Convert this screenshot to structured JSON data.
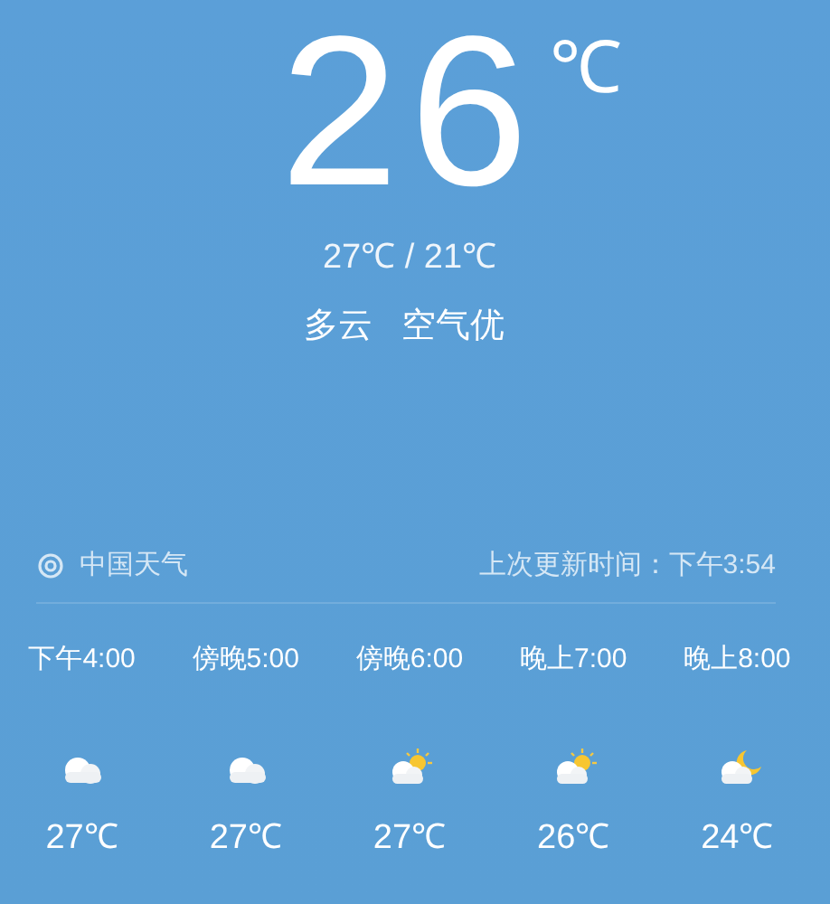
{
  "current": {
    "temperature": "26",
    "unit": "℃",
    "high_low": "27℃ / 21℃",
    "condition": "多云",
    "air_quality": "空气优"
  },
  "source": {
    "name": "中国天气",
    "updated": "上次更新时间：下午3:54"
  },
  "hourly": [
    {
      "time": "下午4:00",
      "kind": "cloudy",
      "temp": "27℃"
    },
    {
      "time": "傍晚5:00",
      "kind": "cloudy",
      "temp": "27℃"
    },
    {
      "time": "傍晚6:00",
      "kind": "partly-sunny",
      "temp": "27℃"
    },
    {
      "time": "晚上7:00",
      "kind": "partly-sunny",
      "temp": "26℃"
    },
    {
      "time": "晚上8:00",
      "kind": "partly-moon",
      "temp": "24℃"
    }
  ]
}
